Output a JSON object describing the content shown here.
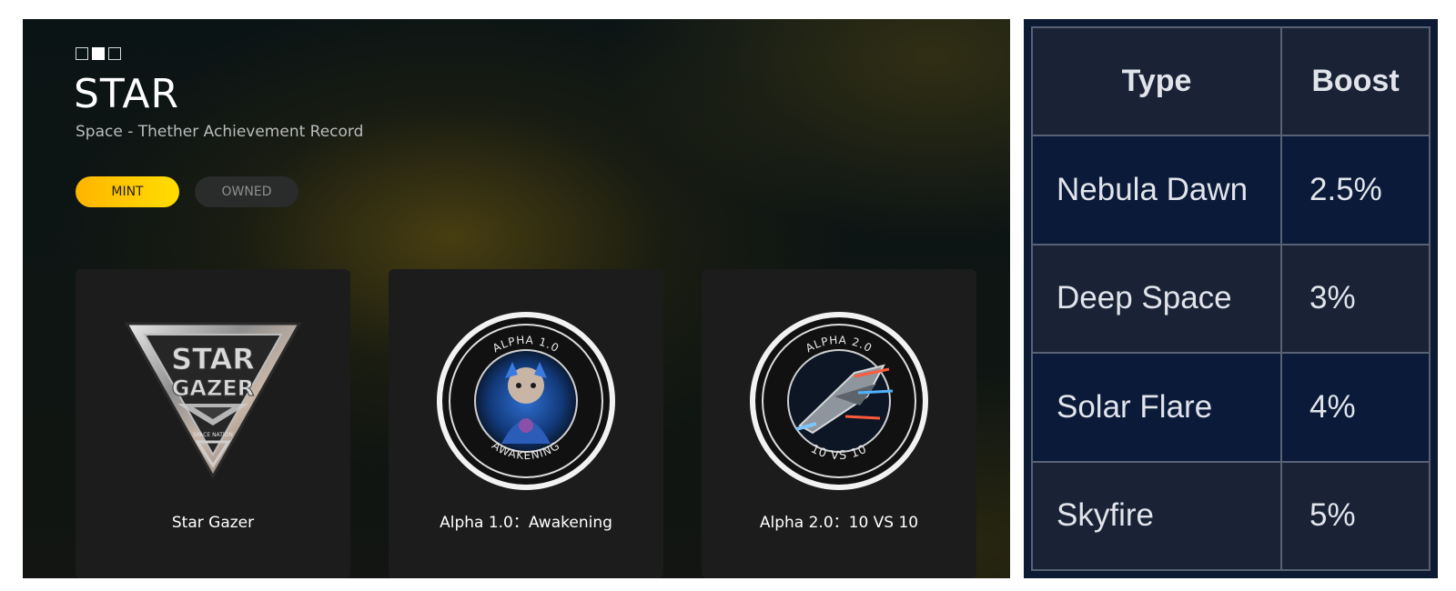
{
  "header": {
    "title": "STAR",
    "subtitle": "Space - Thether Achievement Record",
    "steps": {
      "count": 3,
      "active_index": 1
    }
  },
  "tabs": [
    {
      "label": "MINT",
      "active": true
    },
    {
      "label": "OWNED",
      "active": false
    }
  ],
  "cards": [
    {
      "label": "Star Gazer",
      "icon": "star-gazer-badge",
      "badge_text": [
        "STAR",
        "GAZER",
        "SPACE NATION"
      ]
    },
    {
      "label": "Alpha 1.0：Awakening",
      "icon": "alpha-1-awakening-badge",
      "badge_text": [
        "ALPHA 1.0",
        "AWAKENING"
      ]
    },
    {
      "label": "Alpha 2.0：10 VS 10",
      "icon": "alpha-2-10vs10-badge",
      "badge_text": [
        "ALPHA 2.0",
        "10 VS 10"
      ]
    }
  ],
  "boost_table": {
    "headers": [
      "Type",
      "Boost"
    ],
    "rows": [
      [
        "Nebula Dawn",
        "2.5%"
      ],
      [
        "Deep Space",
        "3%"
      ],
      [
        "Solar Flare",
        "4%"
      ],
      [
        "Skyfire",
        "5%"
      ]
    ]
  },
  "colors": {
    "accent_start": "#ffb400",
    "accent_end": "#ffdd00",
    "card_bg": "#1c1c1c",
    "table_bg": "#0c1a33",
    "table_border": "#596275"
  }
}
